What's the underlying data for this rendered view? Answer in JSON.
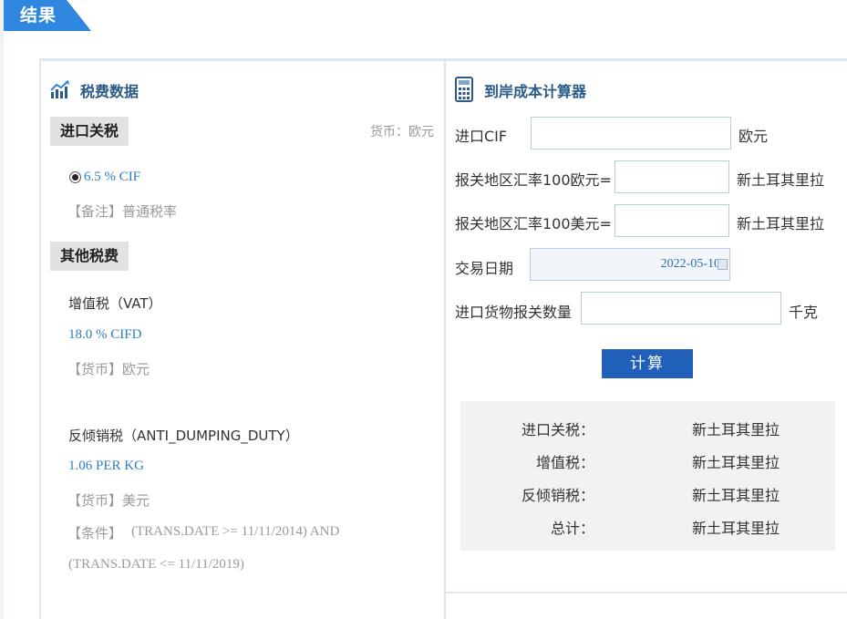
{
  "result_tab": "结果",
  "tax_section": {
    "title": "税费数据",
    "import_duty_tag": "进口关税",
    "currency_note": "货币：欧元",
    "duty_rate": "6.5 % CIF",
    "duty_remark": "【备注】普通税率",
    "other_tag": "其他税费",
    "vat": {
      "name": "增值税（VAT）",
      "rate": "18.0 % CIFD",
      "currency": "【货币】欧元"
    },
    "anti_dumping": {
      "name": "反倾销税（ANTI_DUMPING_DUTY）",
      "rate": "1.06 PER KG",
      "currency": "【货币】美元",
      "condition_prefix": "【条件】",
      "condition_line1": "(TRANS.DATE >= 11/11/2014) AND",
      "condition_line2": "(TRANS.DATE <= 11/11/2019)"
    }
  },
  "calculator": {
    "title": "到岸成本计算器",
    "fields": [
      {
        "label": "进口CIF",
        "value": "",
        "unit": "欧元"
      },
      {
        "label": "报关地区汇率100欧元=",
        "value": "",
        "unit": "新土耳其里拉"
      },
      {
        "label": "报关地区汇率100美元=",
        "value": "",
        "unit": "新土耳其里拉"
      },
      {
        "label": "交易日期",
        "value": "2022-05-10",
        "unit": ""
      },
      {
        "label": "进口货物报关数量",
        "value": "",
        "unit": "千克"
      }
    ],
    "button": "计算",
    "results": [
      {
        "label": "进口关税：",
        "value": "新土耳其里拉"
      },
      {
        "label": "增值税：",
        "value": "新土耳其里拉"
      },
      {
        "label": "反倾销税：",
        "value": "新土耳其里拉"
      },
      {
        "label": "总计：",
        "value": "新土耳其里拉"
      }
    ]
  },
  "colors": {
    "accent": "#2e86de",
    "button": "#2060b8",
    "link": "#2e7cc4"
  }
}
